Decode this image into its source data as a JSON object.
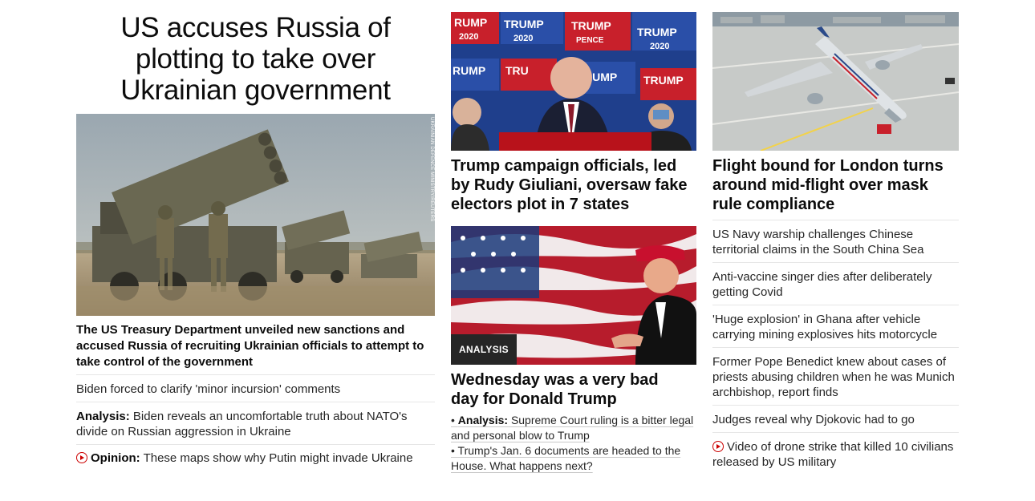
{
  "lead": {
    "headline": "US accuses Russia of plotting to take over Ukrainian government",
    "image_alt": "Ukrainian soldiers beside multiple rocket launchers",
    "image_credit": "UKRAINIAN DEFENCE MINISTRY/REUTERS",
    "description": "The US Treasury Department unveiled new sanctions and accused Russia of recruiting Ukrainian officials to attempt to take control of the government",
    "related": [
      {
        "kicker": "",
        "text": "Biden forced to clarify 'minor incursion' comments",
        "video": false
      },
      {
        "kicker": "Analysis:",
        "text": "Biden reveals an uncomfortable truth about NATO's divide on Russian aggression in Ukraine",
        "video": false
      },
      {
        "kicker": "Opinion:",
        "text": "These maps show why Putin might invade Ukraine",
        "video": true
      }
    ]
  },
  "middle": {
    "card1": {
      "headline": "Trump campaign officials, led by Rudy Giuliani, oversaw fake electors plot in 7 states",
      "image_alt": "Rudy Giuliani speaking at a press conference in front of Trump Pence signs"
    },
    "card2": {
      "badge": "ANALYSIS",
      "headline": "Wednesday was a very bad day for Donald Trump",
      "image_alt": "Donald Trump in front of an American flag",
      "bullets": [
        {
          "kicker": "Analysis:",
          "text": "Supreme Court ruling is a bitter legal and personal blow to Trump"
        },
        {
          "kicker": "",
          "text": "Trump's Jan. 6 documents are headed to the House. What happens next?"
        }
      ]
    }
  },
  "right": {
    "card": {
      "headline": "Flight bound for London turns around mid-flight over mask rule compliance",
      "image_alt": "American Airlines plane on the tarmac"
    },
    "list": [
      {
        "text": "US Navy warship challenges Chinese territorial claims in the South China Sea",
        "video": false
      },
      {
        "text": "Anti-vaccine singer dies after deliberately getting Covid",
        "video": false
      },
      {
        "text": "'Huge explosion' in Ghana after vehicle carrying mining explosives hits motorcycle",
        "video": false
      },
      {
        "text": "Former Pope Benedict knew about cases of priests abusing children when he was Munich archbishop, report finds",
        "video": false
      },
      {
        "text": "Judges reveal why Djokovic had to go",
        "video": false
      },
      {
        "text": "Video of drone strike that killed 10 civilians released by US military",
        "video": true
      }
    ]
  },
  "colors": {
    "video_red": "#cc0000",
    "text": "#0c0c0c",
    "divider": "#e6e6e6",
    "badge_bg": "#262626"
  }
}
